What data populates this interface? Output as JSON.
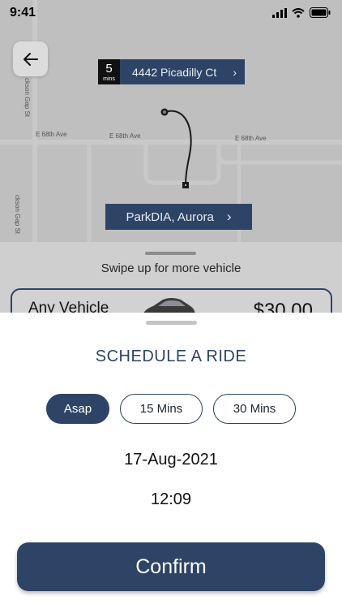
{
  "status_bar": {
    "time": "9:41"
  },
  "map": {
    "streets": {
      "jackson_gap_top": "ckson Gap St",
      "e68_left": "E 68th Ave",
      "e68_mid": "E 68th Ave",
      "e68_right": "E 68th Ave",
      "jackson_gap_bottom": "ckson Gap St"
    },
    "pickup": {
      "eta_value": "5",
      "eta_unit": "mins",
      "address": "4442 Picadilly Ct"
    },
    "dropoff": {
      "address": "ParkDIA, Aurora"
    },
    "route_color": "#111111",
    "tag_color": "#2e4466"
  },
  "swipe": {
    "hint": "Swipe up for more vehicle"
  },
  "vehicle": {
    "name": "Any Vehicle",
    "price": "$30.00"
  },
  "schedule": {
    "title": "SCHEDULE A RIDE",
    "options": [
      {
        "label": "Asap",
        "selected": true
      },
      {
        "label": "15 Mins",
        "selected": false
      },
      {
        "label": "30 Mins",
        "selected": false
      }
    ],
    "date": "17-Aug-2021",
    "time": "12:09",
    "confirm_label": "Confirm"
  },
  "icons": {
    "back": "arrow-left-icon",
    "chevron": "chevron-right-icon",
    "signal": "cellular-signal-icon",
    "wifi": "wifi-icon",
    "battery": "battery-icon"
  }
}
